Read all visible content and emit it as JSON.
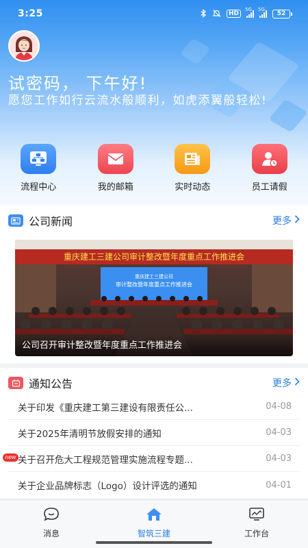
{
  "status_bar": {
    "time": "3:25",
    "signal1_label": "5G",
    "signal2_label": "5G",
    "hd_label": "HD",
    "battery": "52"
  },
  "user": {
    "greeting": "试密码，  下午好!",
    "wish": "愿您工作如行云流水般顺利，如虎添翼般轻松!"
  },
  "quick_actions": [
    {
      "label": "流程中心",
      "icon": "flowchart-icon",
      "color": "#3d8ef5"
    },
    {
      "label": "我的邮箱",
      "icon": "mail-icon",
      "color": "#f0545e"
    },
    {
      "label": "实时动态",
      "icon": "news-icon",
      "color": "#f7a521"
    },
    {
      "label": "员工请假",
      "icon": "leave-icon",
      "color": "#ef4d55"
    }
  ],
  "news": {
    "title": "公司新闻",
    "more": "更多",
    "banner_text": "重庆建工三建公司审计整改暨年度重点工作推进会",
    "screen_line1": "重庆建工三建公司",
    "screen_line2": "审计整改暨年度重点工作推进会",
    "caption": "公司召开审计整改暨年度重点工作推进会"
  },
  "notices": {
    "title": "通知公告",
    "more": "更多",
    "new_badge": "new",
    "items": [
      {
        "text": "关于印发《重庆建工第三建设有限责任公...",
        "date": "04-08"
      },
      {
        "text": "关于2025年清明节放假安排的通知",
        "date": "04-03"
      },
      {
        "text": "关于召开危大工程规范管理实施流程专题...",
        "date": "04-03"
      },
      {
        "text": "关于企业品牌标志（Logo）设计评选的通知",
        "date": "04-01"
      }
    ]
  },
  "tabbar": {
    "tabs": [
      {
        "label": "消息",
        "icon": "message-icon"
      },
      {
        "label": "智筑三建",
        "icon": "home-icon",
        "active": true
      },
      {
        "label": "工作台",
        "icon": "workbench-icon"
      }
    ]
  },
  "colors": {
    "accent": "#2a7ee0",
    "header_top": "#2f8ff0"
  }
}
